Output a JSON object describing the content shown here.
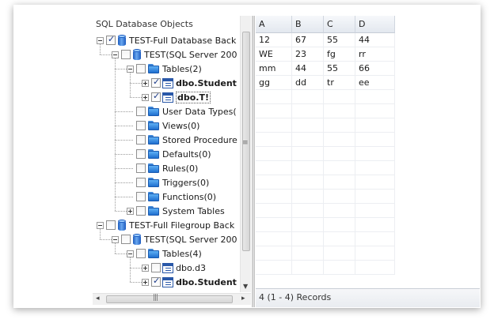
{
  "tree": {
    "title": "SQL Database Objects",
    "nodes": [
      {
        "label": "TEST-Full Database Back",
        "depth": 0,
        "icon": "db-icon",
        "checked": true,
        "expander": "expanded",
        "bold": false
      },
      {
        "label": "TEST(SQL Server 200",
        "depth": 1,
        "icon": "db-icon",
        "checked": false,
        "expander": "expanded",
        "bold": false
      },
      {
        "label": "Tables(2)",
        "depth": 2,
        "icon": "folder-icon",
        "checked": false,
        "expander": "expanded",
        "bold": false
      },
      {
        "label": "dbo.Student",
        "depth": 3,
        "icon": "table-icon",
        "checked": true,
        "expander": "collapsed",
        "bold": true
      },
      {
        "label": "dbo.T!",
        "depth": 3,
        "icon": "table-icon",
        "checked": true,
        "expander": "collapsed",
        "bold": true,
        "selected": true
      },
      {
        "label": "User Data Types(",
        "depth": 2,
        "icon": "folder-icon",
        "checked": false,
        "expander": "none",
        "bold": false
      },
      {
        "label": "Views(0)",
        "depth": 2,
        "icon": "folder-icon",
        "checked": false,
        "expander": "none",
        "bold": false
      },
      {
        "label": "Stored Procedure",
        "depth": 2,
        "icon": "folder-icon",
        "checked": false,
        "expander": "none",
        "bold": false
      },
      {
        "label": "Defaults(0)",
        "depth": 2,
        "icon": "folder-icon",
        "checked": false,
        "expander": "none",
        "bold": false
      },
      {
        "label": "Rules(0)",
        "depth": 2,
        "icon": "folder-icon",
        "checked": false,
        "expander": "none",
        "bold": false
      },
      {
        "label": "Triggers(0)",
        "depth": 2,
        "icon": "folder-icon",
        "checked": false,
        "expander": "none",
        "bold": false
      },
      {
        "label": "Functions(0)",
        "depth": 2,
        "icon": "folder-icon",
        "checked": false,
        "expander": "none",
        "bold": false
      },
      {
        "label": "System Tables",
        "depth": 2,
        "icon": "folder-icon",
        "checked": false,
        "expander": "collapsed",
        "bold": false
      },
      {
        "label": "TEST-Full Filegroup Back",
        "depth": 0,
        "icon": "db-icon",
        "checked": false,
        "expander": "expanded",
        "bold": false
      },
      {
        "label": "TEST(SQL Server 200",
        "depth": 1,
        "icon": "db-icon",
        "checked": false,
        "expander": "expanded",
        "bold": false
      },
      {
        "label": "Tables(4)",
        "depth": 2,
        "icon": "folder-icon",
        "checked": false,
        "expander": "expanded",
        "bold": false
      },
      {
        "label": "dbo.d3",
        "depth": 3,
        "icon": "table-icon",
        "checked": false,
        "expander": "collapsed",
        "bold": false
      },
      {
        "label": "dbo.Student",
        "depth": 3,
        "icon": "table-icon",
        "checked": true,
        "expander": "collapsed",
        "bold": true
      }
    ]
  },
  "grid": {
    "columns": [
      "A",
      "B",
      "C",
      "D"
    ],
    "rows": [
      [
        "12",
        "67",
        "55",
        "44"
      ],
      [
        "WE",
        "23",
        "fg",
        "rr"
      ],
      [
        "mm",
        "44",
        "55",
        "66"
      ],
      [
        "gg",
        "dd",
        "tr",
        "ee"
      ]
    ]
  },
  "status": {
    "records": "4 (1 - 4) Records"
  }
}
